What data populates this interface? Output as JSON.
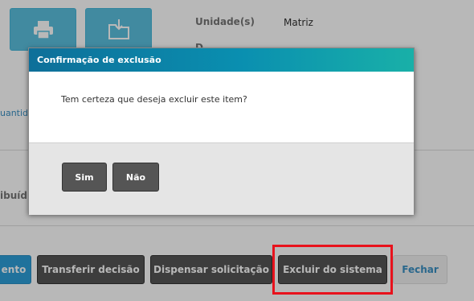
{
  "details": {
    "unit_label": "Unidade(s)",
    "unit_value": "Matriz",
    "partial_label": "D",
    "quantity_link": "uantid",
    "distributed_label": "ibuíd"
  },
  "toolbar": {
    "print_icon": "printer-icon",
    "archive_icon": "download-folder-icon"
  },
  "modal": {
    "title": "Confirmação de exclusão",
    "message": "Tem certeza que deseja excluir este item?",
    "yes_label": "Sim",
    "no_label": "Não"
  },
  "footer": {
    "partial_button_label": "ento",
    "transfer_label": "Transferir decisão",
    "dismiss_label": "Dispensar solicitação",
    "delete_label": "Excluir do sistema",
    "close_label": "Fechar"
  },
  "colors": {
    "accent_blue": "#2d9fd9",
    "icon_button_blue": "#5bc0de",
    "header_gradient_start": "#0e6f99",
    "header_gradient_end": "#19b0a8",
    "dark_button": "#555555",
    "highlight_red": "#e8121c"
  }
}
